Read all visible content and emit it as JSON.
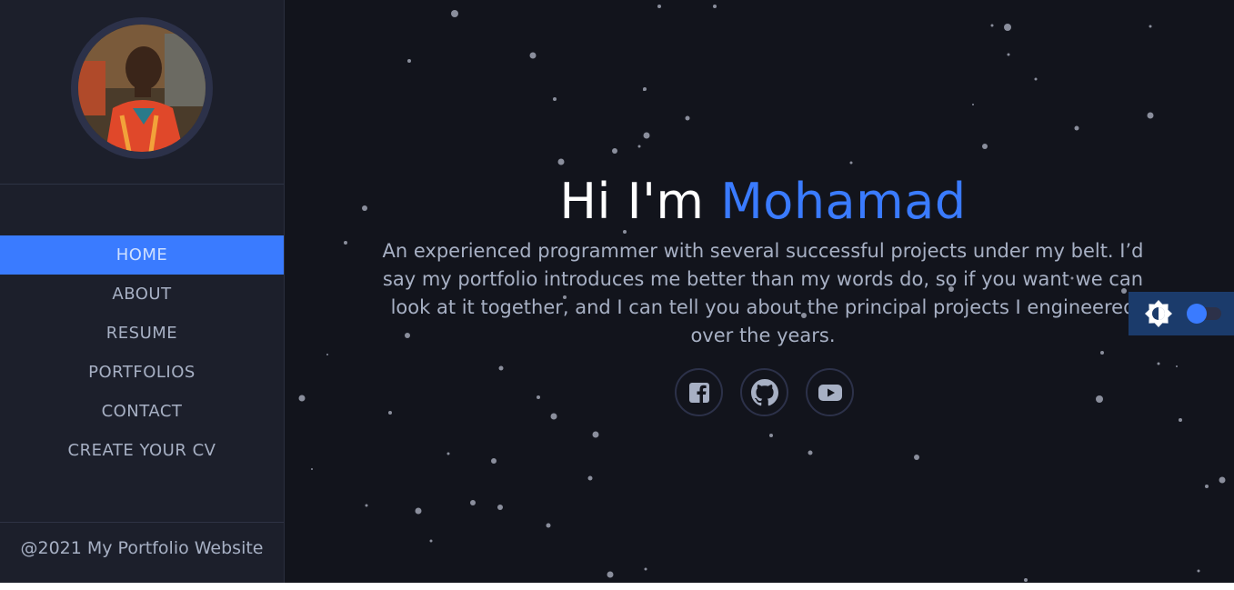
{
  "sidebar": {
    "avatar_alt": "profile photo",
    "nav": [
      {
        "label": "HOME",
        "active": true
      },
      {
        "label": "ABOUT",
        "active": false
      },
      {
        "label": "RESUME",
        "active": false
      },
      {
        "label": "PORTFOLIOS",
        "active": false
      },
      {
        "label": "CONTACT",
        "active": false
      },
      {
        "label": "CREATE YOUR CV",
        "active": false
      }
    ],
    "footer": "@2021 My Portfolio Website"
  },
  "hero": {
    "greeting": "Hi I'm ",
    "name": "Mohamad",
    "description": "An experienced programmer with several successful projects under my belt. I’d say my portfolio introduces me better than my words do, so if you want we can look at it together, and I can tell you about the principal projects I engineered over the years."
  },
  "socials": [
    {
      "icon": "facebook-icon"
    },
    {
      "icon": "github-icon"
    },
    {
      "icon": "youtube-icon"
    }
  ],
  "theme_toggle": {
    "icon": "brightness-icon",
    "enabled": false
  },
  "colors": {
    "accent": "#3a7bff",
    "sidebar_bg": "#1c1f2b",
    "main_bg": "#12141c",
    "text_muted": "#a7b0c4"
  }
}
